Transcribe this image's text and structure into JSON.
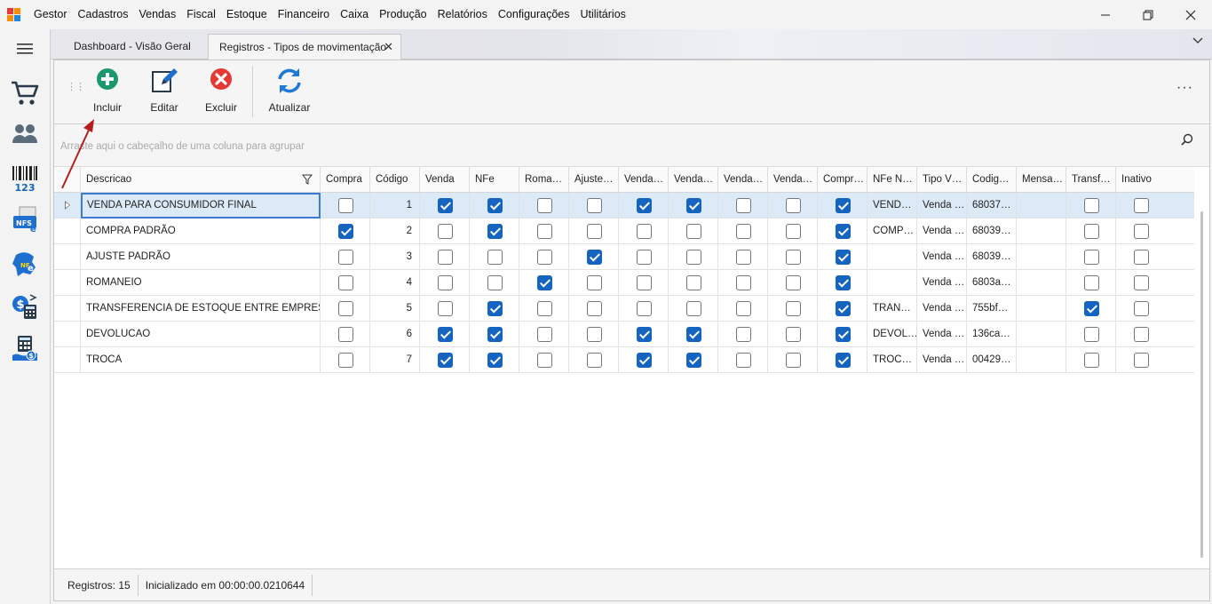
{
  "app": {
    "name": "Gestor"
  },
  "menu": [
    "Cadastros",
    "Vendas",
    "Fiscal",
    "Estoque",
    "Financeiro",
    "Caixa",
    "Produção",
    "Relatórios",
    "Configurações",
    "Utilitários"
  ],
  "window": {
    "minimize": "—",
    "restore": "❐",
    "close": "✕"
  },
  "sidebar": {
    "items": [
      "menu-icon",
      "cart-icon",
      "users-icon",
      "barcode-icon",
      "nfse-icon",
      "nfe-icon",
      "cashier-icon",
      "calculator-icon"
    ]
  },
  "tabs": [
    {
      "label": "Dashboard - Visão Geral"
    },
    {
      "label": "Registros - Tipos de movimentação",
      "close": "✕"
    }
  ],
  "tab_overflow": "⌄",
  "toolbar": {
    "include": "Incluir",
    "edit": "Editar",
    "delete": "Excluir",
    "refresh": "Atualizar",
    "more": "···"
  },
  "group_hint": "Arraste aqui o cabeçalho de uma coluna para agrupar",
  "colors": {
    "accent": "#1565c0",
    "add": "#1a9a6c",
    "delete": "#e53935",
    "refresh": "#1e7ad6",
    "annotation": "#b71c1c"
  },
  "columns": [
    "Descricao",
    "Compra",
    "Código",
    "Venda",
    "NFe",
    "Roma…",
    "Ajuste…",
    "Venda…",
    "Venda…",
    "Venda…",
    "Venda…",
    "Compr…",
    "NFe N…",
    "Tipo V…",
    "Codig…",
    "Mensa…",
    "Transf…",
    "Inativo"
  ],
  "rows": [
    {
      "descricao": "VENDA PARA CONSUMIDOR FINAL",
      "codigo": "1",
      "checks": [
        false,
        true,
        true,
        false,
        false,
        true,
        true,
        false,
        false,
        true
      ],
      "nfe_n": "VEND…",
      "tipo_v": "Venda …",
      "codig": "68037…",
      "mensa": "",
      "transf": false,
      "inativo": false
    },
    {
      "descricao": "COMPRA PADRÃO",
      "codigo": "2",
      "checks": [
        true,
        false,
        true,
        false,
        false,
        false,
        false,
        false,
        false,
        true
      ],
      "nfe_n": "COMP…",
      "tipo_v": "Venda …",
      "codig": "68039…",
      "mensa": "",
      "transf": false,
      "inativo": false
    },
    {
      "descricao": "AJUSTE PADRÃO",
      "codigo": "3",
      "checks": [
        false,
        false,
        false,
        false,
        true,
        false,
        false,
        false,
        false,
        true
      ],
      "nfe_n": "",
      "tipo_v": "Venda …",
      "codig": "68039…",
      "mensa": "",
      "transf": false,
      "inativo": false
    },
    {
      "descricao": "ROMANEIO",
      "codigo": "4",
      "checks": [
        false,
        false,
        false,
        true,
        false,
        false,
        false,
        false,
        false,
        true
      ],
      "nfe_n": "",
      "tipo_v": "Venda …",
      "codig": "6803a…",
      "mensa": "",
      "transf": false,
      "inativo": false
    },
    {
      "descricao": "TRANSFERENCIA DE ESTOQUE ENTRE EMPRESAS",
      "codigo": "5",
      "checks": [
        false,
        false,
        true,
        false,
        false,
        false,
        false,
        false,
        false,
        true
      ],
      "nfe_n": "TRAN…",
      "tipo_v": "Venda …",
      "codig": "755bf…",
      "mensa": "",
      "transf": true,
      "inativo": false
    },
    {
      "descricao": "DEVOLUCAO",
      "codigo": "6",
      "checks": [
        false,
        true,
        true,
        false,
        false,
        true,
        true,
        false,
        false,
        true
      ],
      "nfe_n": "DEVOL…",
      "tipo_v": "Venda …",
      "codig": "136ca…",
      "mensa": "",
      "transf": false,
      "inativo": false
    },
    {
      "descricao": "TROCA",
      "codigo": "7",
      "checks": [
        false,
        true,
        true,
        false,
        false,
        true,
        true,
        false,
        false,
        true
      ],
      "nfe_n": "TROC…",
      "tipo_v": "Venda …",
      "codig": "00429…",
      "mensa": "",
      "transf": false,
      "inativo": false
    }
  ],
  "status": {
    "records": "Registros: 15",
    "initialized": "Inicializado em 00:00:00.0210644"
  }
}
